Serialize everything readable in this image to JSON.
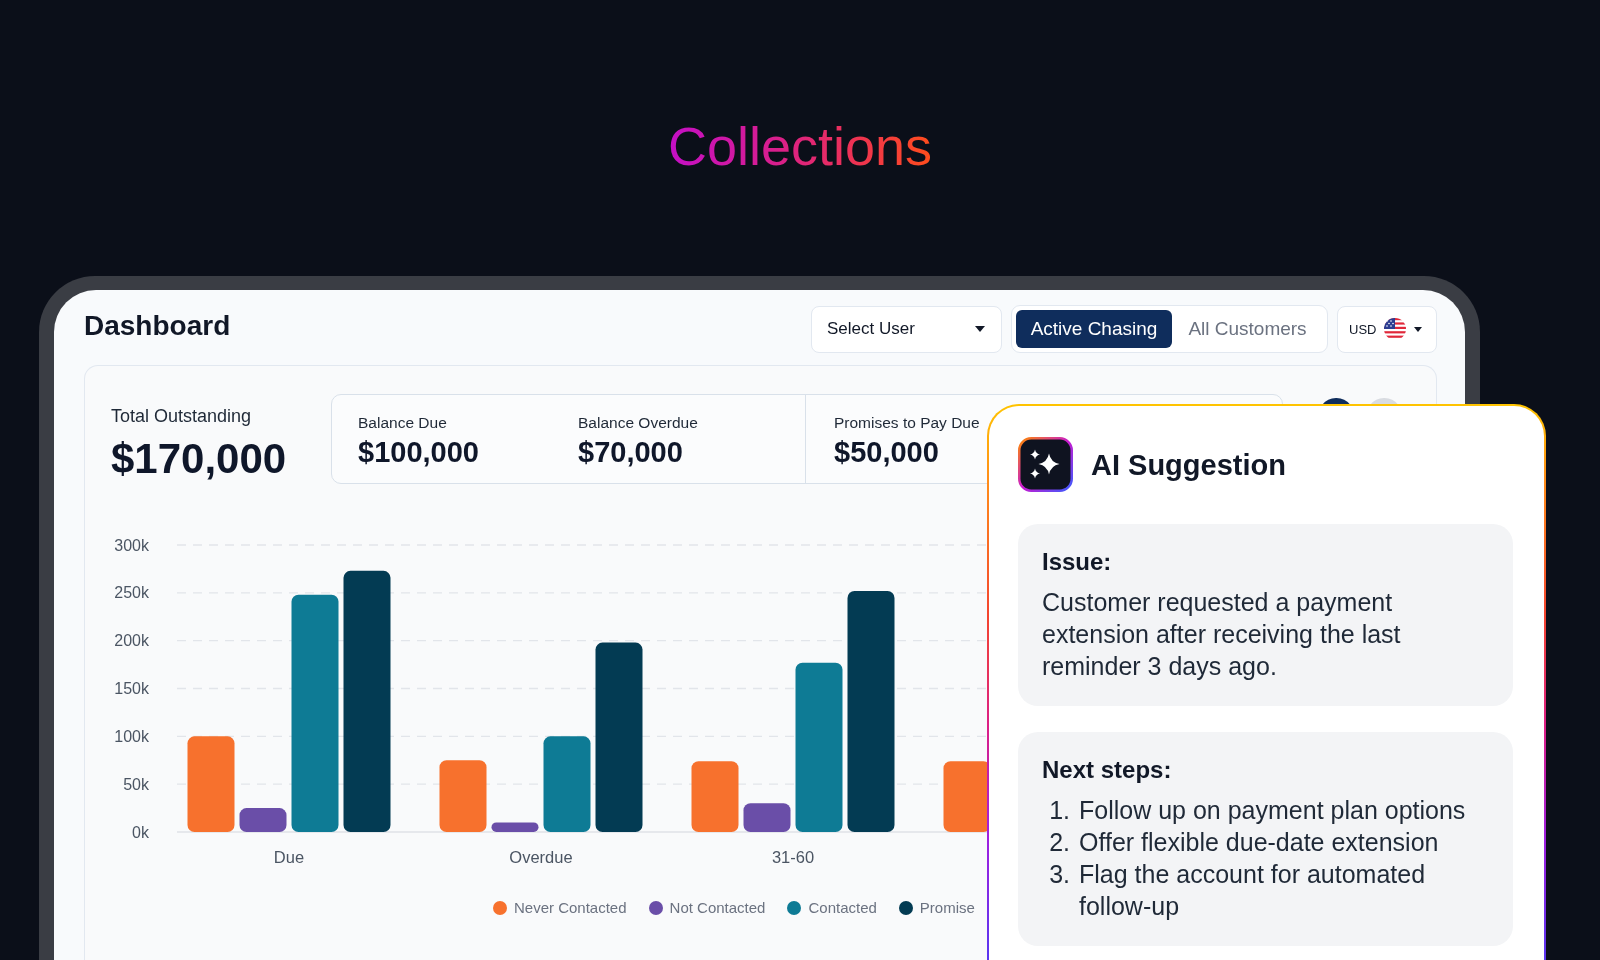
{
  "page_title": "Collections",
  "dashboard": {
    "title": "Dashboard",
    "user_select": {
      "value": "Select User"
    },
    "view_tabs": [
      {
        "label": "Active Chasing",
        "selected": true
      },
      {
        "label": "All Customers",
        "selected": false
      }
    ],
    "currency_select": {
      "value": "USD"
    },
    "total_outstanding": {
      "label": "Total Outstanding",
      "value": "$170,000"
    },
    "stat_groups": [
      {
        "items": [
          {
            "label": "Balance Due",
            "value": "$100,000"
          },
          {
            "label": "Balance Overdue",
            "value": "$70,000"
          }
        ]
      },
      {
        "items": [
          {
            "label": "Promises to Pay Due",
            "value": "$50,000"
          }
        ]
      }
    ],
    "chart_data": {
      "type": "bar",
      "categories": [
        "Due",
        "Overdue",
        "31-60",
        null
      ],
      "series": [
        {
          "name": "Never Contacted",
          "color": "#f7712d",
          "values": [
            100000,
            75000,
            74000,
            74000
          ]
        },
        {
          "name": "Not Contacted",
          "color": "#6a4ea8",
          "values": [
            25000,
            10000,
            30000,
            null
          ]
        },
        {
          "name": "Contacted",
          "color": "#0e7b95",
          "values": [
            248000,
            100000,
            177000,
            null
          ]
        },
        {
          "name": "Promise",
          "color": "#033b53",
          "values": [
            273000,
            198000,
            252000,
            null
          ]
        }
      ],
      "ylim": [
        0,
        300000
      ],
      "yticks": [
        {
          "value": 0,
          "label": "0k"
        },
        {
          "value": 50000,
          "label": "50k"
        },
        {
          "value": 100000,
          "label": "100k"
        },
        {
          "value": 150000,
          "label": "150k"
        },
        {
          "value": 200000,
          "label": "200k"
        },
        {
          "value": 250000,
          "label": "250k"
        },
        {
          "value": 300000,
          "label": "300k"
        }
      ],
      "grid": true
    }
  },
  "ai_suggestion": {
    "title": "AI Suggestion",
    "sections": [
      {
        "kind": "paragraph",
        "heading": "Issue:",
        "text": "Customer requested a payment extension after receiving the last reminder 3 days ago."
      },
      {
        "kind": "list",
        "heading": "Next steps:",
        "items": [
          {
            "number": "1.",
            "text": "Follow up on payment plan options"
          },
          {
            "number": "2.",
            "text": "Offer flexible due-date extension"
          },
          {
            "number": "3.",
            "text": "Flag the account for automated follow-up"
          }
        ]
      }
    ]
  }
}
